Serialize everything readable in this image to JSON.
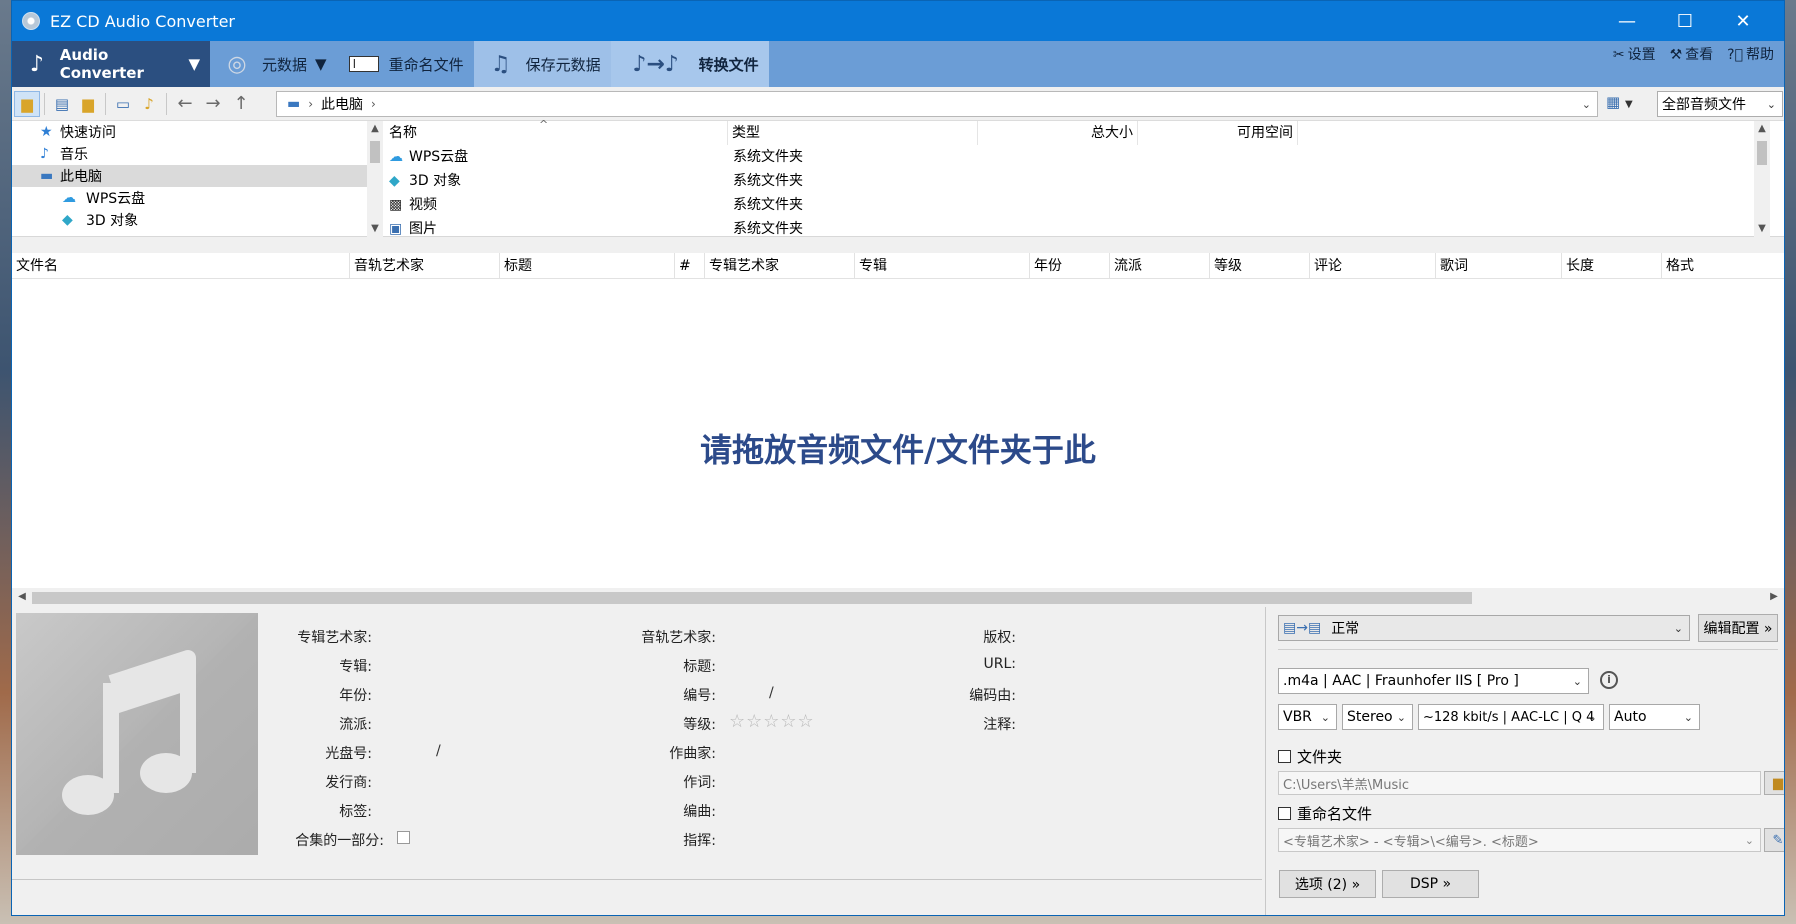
{
  "window": {
    "title": "EZ CD Audio Converter"
  },
  "ribbon": {
    "audio_converter": "Audio Converter",
    "metadata": "元数据",
    "rename": "重命名文件",
    "save_metadata": "保存元数据",
    "convert": "转换文件",
    "settings": "设置",
    "view": "查看",
    "help": "帮助"
  },
  "address": {
    "location": "此电脑",
    "filter": "全部音频文件"
  },
  "tree": {
    "items": [
      {
        "label": "快速访问",
        "icon": "star-icon"
      },
      {
        "label": "音乐",
        "icon": "music-note-icon"
      },
      {
        "label": "此电脑",
        "icon": "computer-icon"
      },
      {
        "label": "WPS云盘",
        "icon": "cloud-icon"
      },
      {
        "label": "3D 对象",
        "icon": "cube-icon"
      }
    ]
  },
  "filelist": {
    "headers": {
      "name": "名称",
      "type": "类型",
      "total": "总大小",
      "free": "可用空间"
    },
    "rows": [
      {
        "name": "WPS云盘",
        "type": "系统文件夹",
        "icon": "cloud-icon"
      },
      {
        "name": "3D 对象",
        "type": "系统文件夹",
        "icon": "cube-icon"
      },
      {
        "name": "视频",
        "type": "系统文件夹",
        "icon": "film-icon"
      },
      {
        "name": "图片",
        "type": "系统文件夹",
        "icon": "picture-icon"
      }
    ]
  },
  "tracks": {
    "headers": [
      "文件名",
      "音轨艺术家",
      "标题",
      "#",
      "专辑艺术家",
      "专辑",
      "年份",
      "流派",
      "等级",
      "评论",
      "歌词",
      "长度",
      "格式"
    ],
    "drop_hint": "请拖放音频文件/文件夹于此"
  },
  "metadata": {
    "album_artist": "专辑艺术家:",
    "album": "专辑:",
    "year": "年份:",
    "genre": "流派:",
    "disc": "光盘号:",
    "disc_sep": "/",
    "publisher": "发行商:",
    "tags": "标签:",
    "compilation": "合集的一部分:",
    "track_artist": "音轨艺术家:",
    "title": "标题:",
    "number": "编号:",
    "number_sep": "/",
    "rating": "等级:",
    "stars": "☆☆☆☆☆",
    "composer": "作曲家:",
    "lyricist": "作词:",
    "arranger": "编曲:",
    "conductor": "指挥:",
    "copyright": "版权:",
    "url": "URL:",
    "encoded_by": "编码由:",
    "comment": "注释:"
  },
  "profile": {
    "preset": "正常",
    "edit_profile": "编辑配置 »",
    "format": ".m4a  |  AAC  |  Fraunhofer IIS [ Pro ]",
    "mode": "VBR",
    "channels": "Stereo",
    "quality": "~128 kbit/s | AAC-LC | Q 4",
    "sample_rate": "Auto",
    "folder_label": "文件夹",
    "folder_path": "C:\\Users\\羊羔\\Music",
    "rename_label": "重命名文件",
    "rename_pattern": "<专辑艺术家> - <专辑>\\<编号>. <标题>",
    "options": "选项 (2) »",
    "dsp": "DSP »"
  }
}
